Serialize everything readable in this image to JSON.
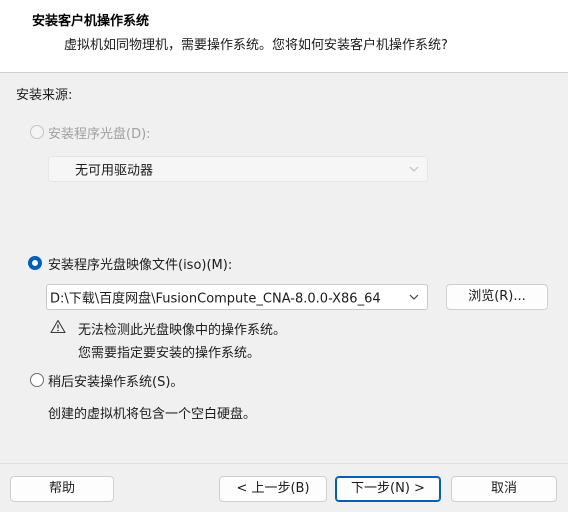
{
  "header": {
    "title": "安装客户机操作系统",
    "subtitle": "虚拟机如同物理机，需要操作系统。您将如何安装客户机操作系统?"
  },
  "install_source_label": "安装来源:",
  "options": {
    "disc": {
      "label": "安装程序光盘(D):",
      "selected": false,
      "enabled": false,
      "drive_value": "无可用驱动器"
    },
    "iso": {
      "label": "安装程序光盘映像文件(iso)(M):",
      "selected": true,
      "path_value": "D:\\下载\\百度网盘\\FusionCompute_CNA-8.0.0-X86_64",
      "browse_label": "浏览(R)...",
      "warning_line1": "无法检测此光盘映像中的操作系统。",
      "warning_line2": "您需要指定要安装的操作系统。"
    },
    "later": {
      "label": "稍后安装操作系统(S)。",
      "selected": false,
      "description": "创建的虚拟机将包含一个空白硬盘。"
    }
  },
  "footer": {
    "help": "帮助",
    "back": "< 上一步(B)",
    "next": "下一步(N) >",
    "cancel": "取消"
  },
  "colors": {
    "accent": "#005fb8",
    "background": "#f0f0f0"
  }
}
